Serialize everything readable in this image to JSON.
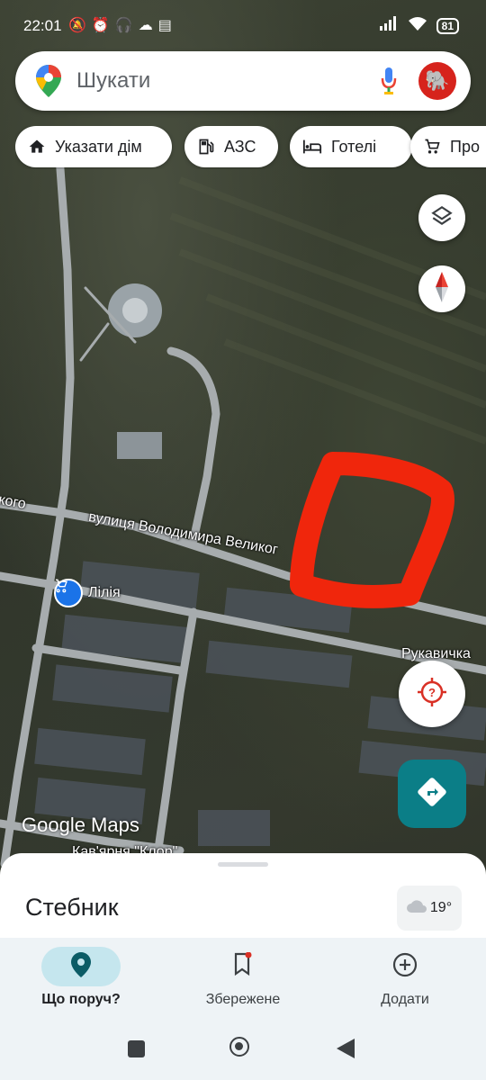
{
  "status_bar": {
    "time": "22:01",
    "left_icons": "🔕⏰🎧☁▤",
    "battery": "81"
  },
  "search": {
    "placeholder": "Шукати"
  },
  "chips": [
    {
      "label": "Указати дім",
      "icon": "home-icon"
    },
    {
      "label": "АЗС",
      "icon": "gas-station-icon"
    },
    {
      "label": "Готелі",
      "icon": "hotel-icon"
    },
    {
      "label": "Про",
      "icon": "cart-icon"
    }
  ],
  "map": {
    "street_label": "вулиця Володимира Великог",
    "street_label_left": "кого",
    "poi_lilia": "Лілія",
    "poi_rukavychka": "Рукавичка",
    "poi_bottom": "Кав'ярня \"Клор\"",
    "logo": "Google Maps",
    "highlight_color": "#f0260c"
  },
  "sheet": {
    "place_name": "Стебник",
    "temperature": "19°"
  },
  "bottom_nav": [
    {
      "label": "Що поруч?",
      "icon": "explore-pin-icon",
      "active": true
    },
    {
      "label": "Збережене",
      "icon": "bookmark-icon",
      "active": false
    },
    {
      "label": "Додати",
      "icon": "add-circle-icon",
      "active": false
    }
  ],
  "colors": {
    "accent": "#0b7e87",
    "nav_active": "#c5e6ee"
  }
}
